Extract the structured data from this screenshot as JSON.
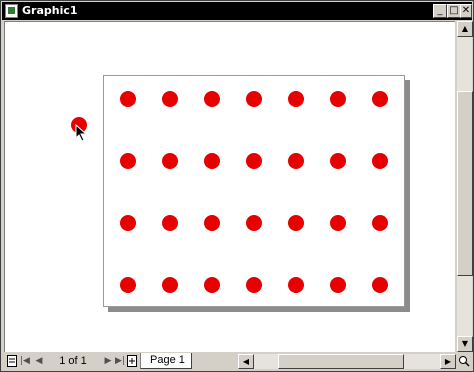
{
  "window": {
    "title": "Graphic1",
    "icons": {
      "app": "document-icon",
      "minimize": "minimize-icon",
      "maximize": "maximize-icon",
      "close": "close-icon"
    },
    "buttons": {
      "minimize": "_",
      "maximize": "□",
      "close": "✕"
    }
  },
  "canvas": {
    "dot_color": "#e60000",
    "page_grid": {
      "rows": 4,
      "columns": 7
    },
    "loose_object": "red-dot",
    "pointer": "arrow-cursor-icon"
  },
  "bottom_bar": {
    "page_count": "1 of 1",
    "page_tab": "Page 1",
    "nav_icons": [
      "page-icon",
      "first-page-icon",
      "previous-page-icon",
      "next-page-icon",
      "last-page-icon",
      "insert-page-icon"
    ]
  }
}
